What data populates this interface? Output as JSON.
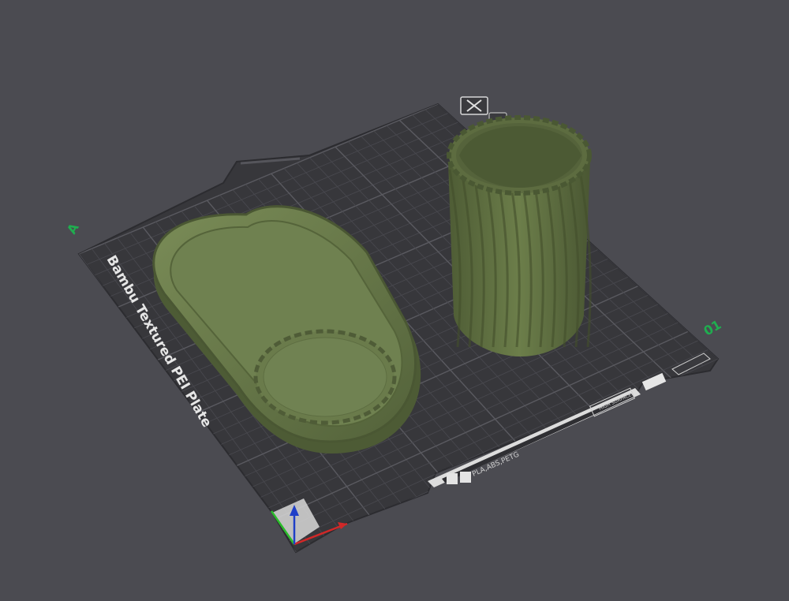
{
  "plate": {
    "name": "Bambu Textured PEI Plate",
    "label_a": "A",
    "label_01": "01",
    "material_tag": "PLA,ABS,PETG",
    "surface_tag": "HIGH\nSURFACE",
    "colors": {
      "background": "#4b4b51",
      "plate": "#37373b",
      "grid": "#4f4f55",
      "accent_green": "#1fae4f"
    }
  },
  "objects": [
    {
      "name": "oval-tray",
      "color": "#657648"
    },
    {
      "name": "twisted-vase",
      "color": "#5b6a3f"
    }
  ],
  "axes": {
    "x_color": "#d02828",
    "y_color": "#2bbd2b",
    "z_color": "#1f3fc8"
  }
}
